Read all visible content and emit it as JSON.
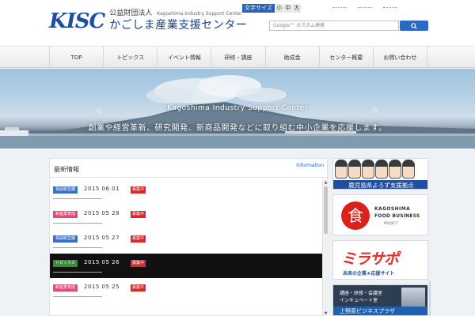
{
  "header": {
    "logo_mark": "KISC",
    "logo_corp": "公益財団法人",
    "logo_en": "Kagoshima Industry Support Center",
    "logo_jp": "かごしま産業支援センター",
    "fontsize_label": "文字サイズ",
    "fontsize_options": [
      "小",
      "中",
      "大"
    ],
    "search_placeholder": "Google™ カスタム検索",
    "search_icon": "search-icon",
    "toplinks_count": 3
  },
  "nav": {
    "items": [
      "TOP",
      "トピックス",
      "イベント情報",
      "研修・講座",
      "助成金",
      "センター概要",
      "お問い合わせ"
    ]
  },
  "hero": {
    "title_en": "Kagoshima Industry Support Center",
    "title_jp": "創業や経営革新、研究開発、新商品開発などに取り組む中小企業を応援します。"
  },
  "news": {
    "title": "最新情報",
    "more_label": "Information",
    "items": [
      {
        "category": "相談経営課",
        "date": "2015 06 01",
        "badge": "募集中",
        "cat_color": "#3b6fc6",
        "dark": false
      },
      {
        "category": "新産業育成",
        "date": "2015 05 28",
        "badge": "募集中",
        "cat_color": "#e04a75",
        "dark": false
      },
      {
        "category": "相談経営課",
        "date": "2015 05 27",
        "badge": "募集中",
        "cat_color": "#3b6fc6",
        "dark": false
      },
      {
        "category": "トピックス",
        "date": "2015 05 26",
        "badge": "募集中",
        "cat_color": "#3a8a3a",
        "dark": true
      },
      {
        "category": "新産業育成",
        "date": "2015 05 25",
        "badge": "募集中",
        "cat_color": "#e04a75",
        "dark": false
      }
    ]
  },
  "sidebar": {
    "yorozu_label": "鹿児島県よろず支援拠点",
    "kago_circle": "食",
    "kago_line1": "KAGOSHIMA",
    "kago_line2": "FOOD BUSINESS",
    "kago_line3": "PROJECT",
    "mira_title": "ミラサポ",
    "mira_sub": "未来の企業★応援サイト",
    "facility_line1": "講座・研修・会議室",
    "facility_line2": "インキュベート室",
    "facility_bar": "上野原ビジネスプラザ"
  }
}
